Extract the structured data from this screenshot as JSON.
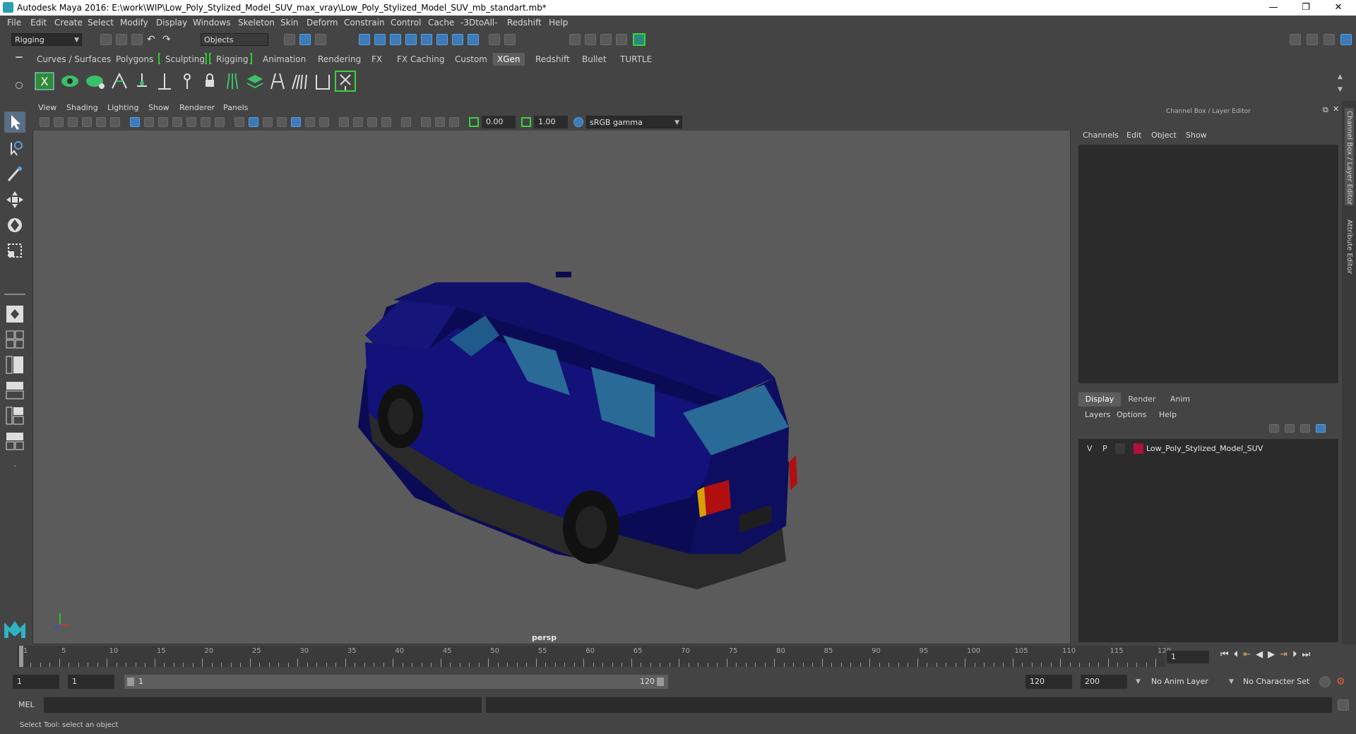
{
  "window": {
    "title": "Autodesk Maya 2016: E:\\work\\WIP\\Low_Poly_Stylized_Model_SUV_max_vray\\Low_Poly_Stylized_Model_SUV_mb_standart.mb*",
    "minimize": "—",
    "restore": "❐",
    "close": "✕"
  },
  "menubar": [
    "File",
    "Edit",
    "Create",
    "Select",
    "Modify",
    "Display",
    "Windows",
    "Skeleton",
    "Skin",
    "Deform",
    "Constrain",
    "Control",
    "Cache",
    "-3DtoAll-",
    "Redshift",
    "Help"
  ],
  "statusline": {
    "mode": "Rigging",
    "selection_mode": "Objects"
  },
  "shelf": {
    "tabs": [
      "Curves / Surfaces",
      "Polygons",
      "Sculpting",
      "Rigging",
      "Animation",
      "Rendering",
      "FX",
      "FX Caching",
      "Custom",
      "XGen",
      "Redshift",
      "Bullet",
      "TURTLE"
    ],
    "active_tab": "XGen"
  },
  "viewport": {
    "menu": [
      "View",
      "Shading",
      "Lighting",
      "Show",
      "Renderer",
      "Panels"
    ],
    "exposure": "0.00",
    "gamma": "1.00",
    "colorspace": "sRGB gamma",
    "camera_label": "persp"
  },
  "channelbox": {
    "title": "Channel Box / Layer Editor",
    "menu": [
      "Channels",
      "Edit",
      "Object",
      "Show"
    ],
    "layer_tabs": [
      "Display",
      "Render",
      "Anim"
    ],
    "active_layer_tab": "Display",
    "layer_menu": [
      "Layers",
      "Options",
      "Help"
    ],
    "layers": [
      {
        "v": "V",
        "p": "P",
        "color": "#b0103a",
        "name": "Low_Poly_Stylized_Model_SUV"
      }
    ],
    "side_tabs": [
      "Channel Box / Layer Editor",
      "Attribute Editor"
    ]
  },
  "timeslider": {
    "ticks": [
      1,
      5,
      10,
      15,
      20,
      25,
      30,
      35,
      40,
      45,
      50,
      55,
      60,
      65,
      70,
      75,
      80,
      85,
      90,
      95,
      100,
      105,
      110,
      115,
      120
    ],
    "min": 1,
    "max": 120,
    "current_frame": "1"
  },
  "range": {
    "start": "1",
    "anim_start": "1",
    "range_start_label": "1",
    "range_end_label": "120",
    "end": "120",
    "anim_end": "200",
    "anim_layer": "No Anim Layer",
    "character_set": "No Character Set"
  },
  "cmdline": {
    "label": "MEL"
  },
  "helpline": {
    "text": "Select Tool: select an object"
  }
}
